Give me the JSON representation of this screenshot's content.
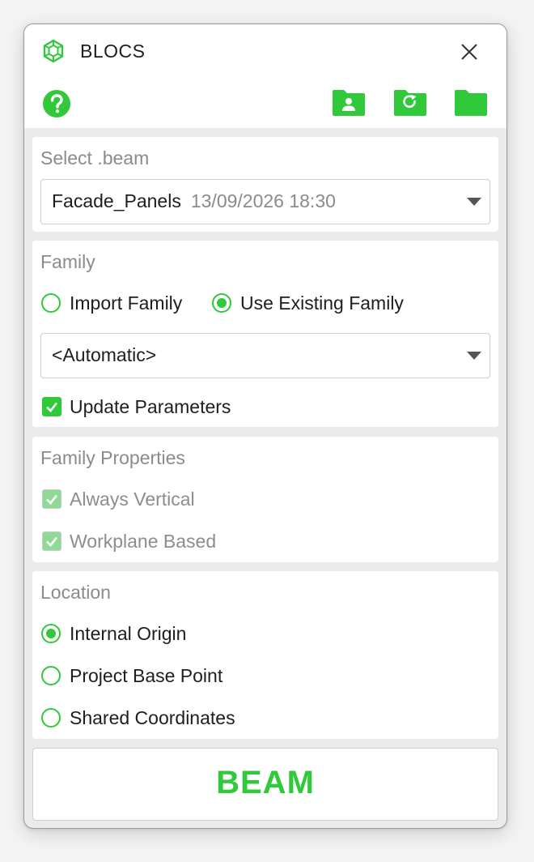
{
  "app": {
    "title": "BLOCS"
  },
  "colors": {
    "accent": "#2fc93a",
    "muted_text": "#8b8b8b",
    "panel_bg": "#ffffff",
    "window_bg": "#ebebeb"
  },
  "icons": {
    "logo": "hexagon-cube-icon",
    "close": "close-icon",
    "help": "help-circle-icon",
    "user_folder": "user-folder-icon",
    "refresh": "refresh-icon",
    "folder": "folder-icon"
  },
  "select_beam": {
    "title": "Select .beam",
    "selected_name": "Facade_Panels",
    "selected_date": "13/09/2026 18:30"
  },
  "family": {
    "title": "Family",
    "import_label": "Import Family",
    "import_selected": false,
    "existing_label": "Use Existing Family",
    "existing_selected": true,
    "family_select_value": "<Automatic>",
    "update_parameters_label": "Update Parameters",
    "update_parameters_checked": true
  },
  "family_properties": {
    "title": "Family Properties",
    "always_vertical_label": "Always Vertical",
    "always_vertical_checked": true,
    "workplane_based_label": "Workplane Based",
    "workplane_based_checked": true
  },
  "location": {
    "title": "Location",
    "options": [
      {
        "label": "Internal Origin",
        "selected": true
      },
      {
        "label": "Project Base Point",
        "selected": false
      },
      {
        "label": "Shared Coordinates",
        "selected": false
      }
    ]
  },
  "action": {
    "beam_label": "BEAM"
  }
}
